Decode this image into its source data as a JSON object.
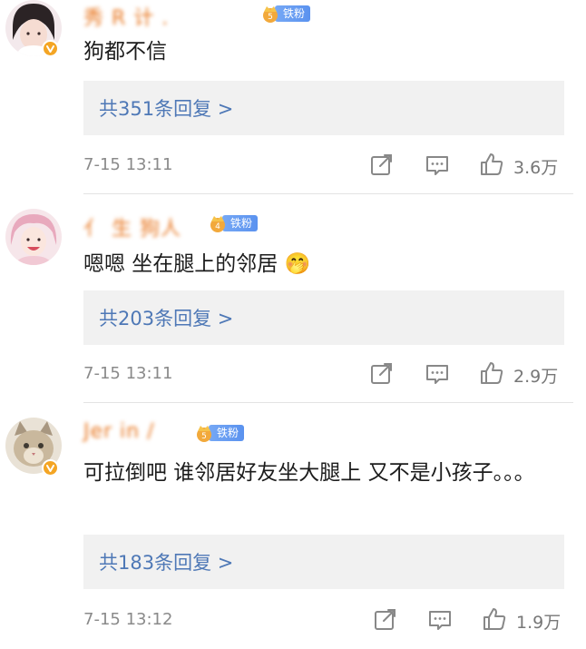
{
  "colors": {
    "username": "#e8761f",
    "reply_link": "#4e78b6",
    "fan_badge": "#5a92ef",
    "verified_badge": "#f4a524",
    "meta_text": "#8a8a8a",
    "reply_box_bg": "#f1f1f1"
  },
  "comments": [
    {
      "username": "秀 R 计  .",
      "fan_badge": "铁粉",
      "text": "狗都不信",
      "reply_count_label": "共351条回复 >",
      "time": "7-15 13:11",
      "likes": "3.6万",
      "icons": [
        "share-icon",
        "comment-icon",
        "like-icon"
      ]
    },
    {
      "username": "亻 生 狗人",
      "fan_badge": "铁粉",
      "text": "嗯嗯 坐在腿上的邻居 🤭",
      "reply_count_label": "共203条回复 >",
      "time": "7-15 13:11",
      "likes": "2.9万",
      "icons": [
        "share-icon",
        "comment-icon",
        "like-icon"
      ]
    },
    {
      "username": "Jer in /",
      "fan_badge": "铁粉",
      "text": "可拉倒吧 谁邻居好友坐大腿上 又不是小孩子。。。",
      "reply_count_label": "共183条回复 >",
      "time": "7-15 13:12",
      "likes": "1.9万",
      "icons": [
        "share-icon",
        "comment-icon",
        "like-icon"
      ]
    }
  ]
}
